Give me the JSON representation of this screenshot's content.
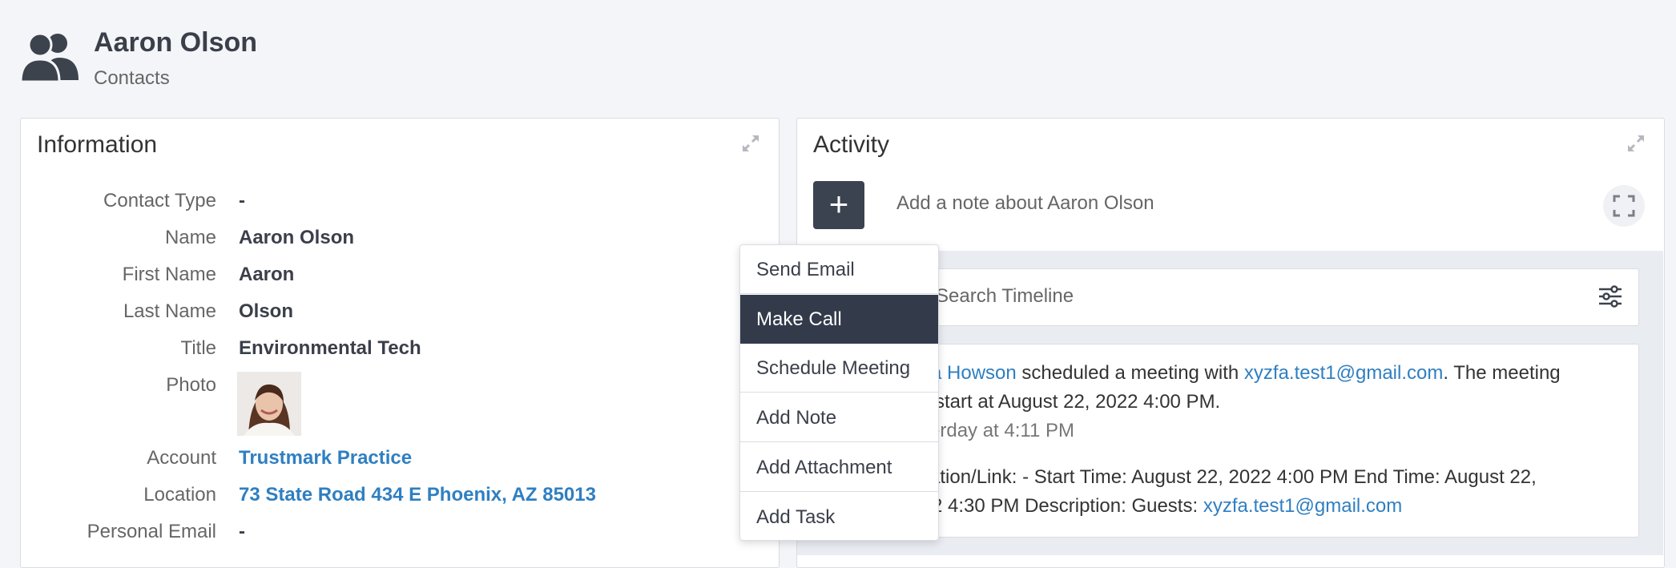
{
  "header": {
    "title": "Aaron Olson",
    "subtitle": "Contacts",
    "icon": "contacts-icon"
  },
  "information": {
    "title": "Information",
    "rows": [
      {
        "label": "Contact Type",
        "value": "-"
      },
      {
        "label": "Name",
        "value": "Aaron Olson"
      },
      {
        "label": "First Name",
        "value": "Aaron"
      },
      {
        "label": "Last Name",
        "value": "Olson"
      },
      {
        "label": "Title",
        "value": "Environmental Tech"
      },
      {
        "label": "Photo",
        "value": ""
      },
      {
        "label": "Account",
        "value": "Trustmark Practice"
      },
      {
        "label": "Location",
        "value": "73 State Road 434 E Phoenix, AZ 85013"
      },
      {
        "label": "Personal Email",
        "value": "-"
      }
    ]
  },
  "activity": {
    "title": "Activity",
    "add_button": "+",
    "note_placeholder": "Add a note about Aaron Olson",
    "search_placeholder": "Search Timeline",
    "event": {
      "line1_user": "a Howson",
      "line1_text": " scheduled a meeting with ",
      "line1_email": "xyzfa.test1@gmail.com",
      "line1_tail": ". The meeting",
      "line2": "start at August 22, 2022 4:00 PM.",
      "time": "erday at 4:11 PM",
      "detail1": "ation/Link: - Start Time: August 22, 2022 4:00 PM End Time: August 22,",
      "detail2_text": "2 4:30 PM Description: Guests: ",
      "detail2_email": "xyzfa.test1@gmail.com"
    }
  },
  "menu": {
    "items": [
      {
        "label": "Send Email"
      },
      {
        "label": "Make Call"
      },
      {
        "label": "Schedule Meeting"
      },
      {
        "label": "Add Note"
      },
      {
        "label": "Add Attachment"
      },
      {
        "label": "Add Task"
      }
    ],
    "active": "Make Call"
  },
  "colors": {
    "accent": "#2f7fc1",
    "dark": "#333b4b"
  }
}
